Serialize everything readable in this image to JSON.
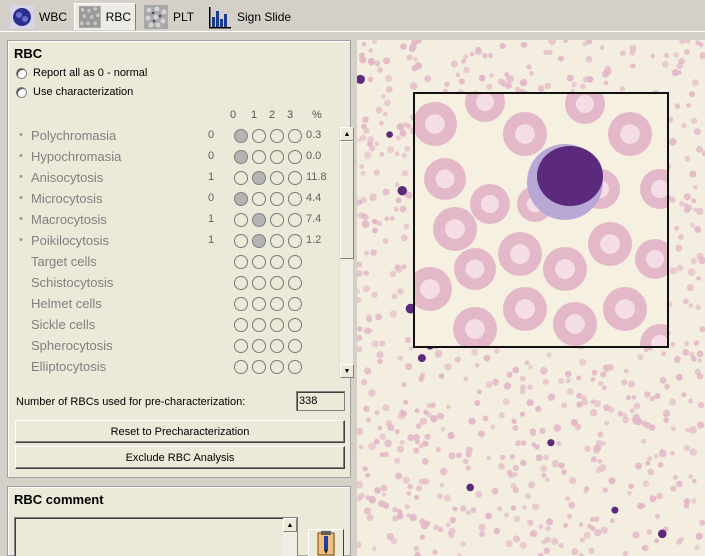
{
  "tabs": [
    {
      "label": "WBC",
      "icon": "wbc-cell-icon",
      "active": false
    },
    {
      "label": "RBC",
      "icon": "rbc-cells-icon",
      "active": true
    },
    {
      "label": "PLT",
      "icon": "plt-cells-icon",
      "active": false
    },
    {
      "label": "Sign Slide",
      "icon": "bar-chart-icon",
      "active": false
    }
  ],
  "rbc": {
    "title": "RBC",
    "option_normal": "Report all as 0 - normal",
    "option_characterization": "Use characterization",
    "grade_headers": [
      "0",
      "1",
      "2",
      "3"
    ],
    "pct_header": "%",
    "rows": [
      {
        "name": "Polychromasia",
        "grade": "0",
        "selected": 0,
        "pct": "0.3",
        "bullet": true
      },
      {
        "name": "Hypochromasia",
        "grade": "0",
        "selected": 0,
        "pct": "0.0",
        "bullet": true
      },
      {
        "name": "Anisocytosis",
        "grade": "1",
        "selected": 1,
        "pct": "11.8",
        "bullet": true
      },
      {
        "name": "Microcytosis",
        "grade": "0",
        "selected": 0,
        "pct": "4.4",
        "bullet": true
      },
      {
        "name": "Macrocytosis",
        "grade": "1",
        "selected": 1,
        "pct": "7.4",
        "bullet": true
      },
      {
        "name": "Poikilocytosis",
        "grade": "1",
        "selected": 1,
        "pct": "1.2",
        "bullet": true
      },
      {
        "name": "Target cells",
        "grade": "",
        "selected": -1,
        "pct": "",
        "bullet": false
      },
      {
        "name": "Schistocytosis",
        "grade": "",
        "selected": -1,
        "pct": "",
        "bullet": false
      },
      {
        "name": "Helmet cells",
        "grade": "",
        "selected": -1,
        "pct": "",
        "bullet": false
      },
      {
        "name": "Sickle cells",
        "grade": "",
        "selected": -1,
        "pct": "",
        "bullet": false
      },
      {
        "name": "Spherocytosis",
        "grade": "",
        "selected": -1,
        "pct": "",
        "bullet": false
      },
      {
        "name": "Elliptocytosis",
        "grade": "",
        "selected": -1,
        "pct": "",
        "bullet": false
      }
    ],
    "count_label": "Number of RBCs used for pre-characterization:",
    "count_value": "338",
    "reset_button": "Reset to Precharacterization",
    "exclude_button": "Exclude RBC Analysis"
  },
  "comment": {
    "title": "RBC comment"
  },
  "colors": {
    "panel_bg": "#ece9d8",
    "rbc_fill": "#e3b8c8",
    "rbc_center": "#f4dde4",
    "nucleus": "#5b2a7d",
    "cytoplasm": "#b9a8d6"
  }
}
